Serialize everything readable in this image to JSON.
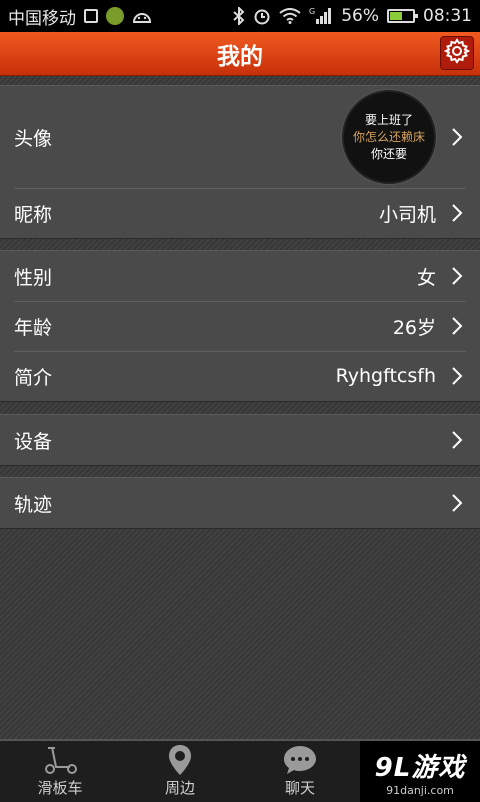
{
  "status_bar": {
    "carrier": "中国移动",
    "battery": "56%",
    "battery_level": 0.56,
    "time": "08:31",
    "network": "G"
  },
  "header": {
    "title": "我的"
  },
  "profile": {
    "avatar": {
      "label": "头像",
      "lines": [
        "要上班了",
        "你怎么还赖床",
        "你还要"
      ]
    },
    "nickname": {
      "label": "昵称",
      "value": "小司机"
    },
    "gender": {
      "label": "性别",
      "value": "女"
    },
    "age": {
      "label": "年龄",
      "value": "26岁"
    },
    "bio": {
      "label": "简介",
      "value": "Ryhgftcsfh"
    },
    "device": {
      "label": "设备"
    },
    "track": {
      "label": "轨迹"
    }
  },
  "bottom_nav": {
    "tabs": [
      {
        "label": "滑板车",
        "icon": "scooter-icon"
      },
      {
        "label": "周边",
        "icon": "location-pin-icon"
      },
      {
        "label": "聊天",
        "icon": "chat-bubble-icon"
      }
    ]
  },
  "watermark": {
    "main": "9L游戏",
    "sub": "91danji.com"
  },
  "colors": {
    "header_accent": "#e8481a",
    "avatar_highlight": "#d6a35c"
  }
}
